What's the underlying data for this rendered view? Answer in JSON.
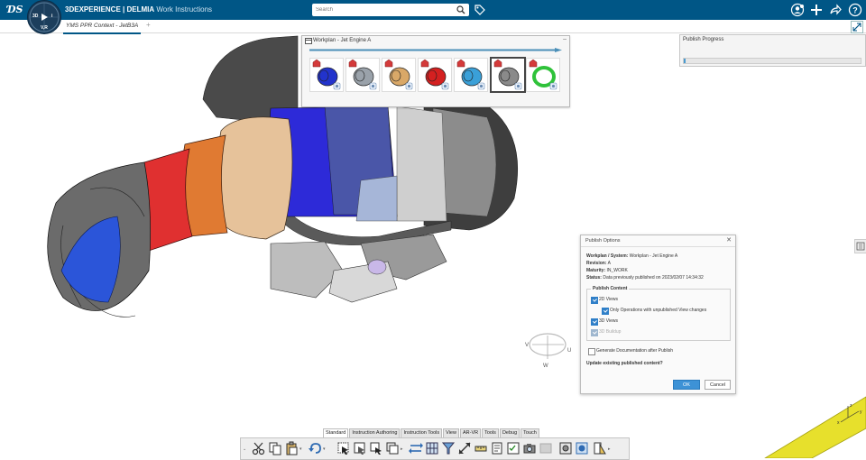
{
  "topbar": {
    "brand_name": "3DEXPERIENCE | DELMIA",
    "app_name": "Work Instructions",
    "search_placeholder": "Search",
    "compass_labels": {
      "north": "3D",
      "west": "3D",
      "east": "i",
      "south": "V,R"
    },
    "accent_color": "#005686"
  },
  "tabs": {
    "context_tab": "YMS PPR Context - JetB3A"
  },
  "workplan": {
    "title": "Workplan - Jet Engine A",
    "thumbnails": [
      {
        "name": "fan-blue",
        "color": "#2233cc"
      },
      {
        "name": "compressor-silver",
        "color": "#9aa2aa"
      },
      {
        "name": "combustor-tan",
        "color": "#d9a868"
      },
      {
        "name": "turbine-red",
        "color": "#d42020"
      },
      {
        "name": "assembly-mixed",
        "color": "#3aa0d8"
      },
      {
        "name": "frame-gray",
        "color": "#8a8a8a"
      },
      {
        "name": "ring-green",
        "color": "#2fc23a"
      }
    ],
    "selected_index": 5
  },
  "publish_progress": {
    "title": "Publish Progress",
    "progress_fraction": 0.01
  },
  "dialog": {
    "title": "Publish Options",
    "workplan_label": "Workplan / System:",
    "workplan_value": "Workplan - Jet Engine A",
    "revision_label": "Revision:",
    "revision_value": "A",
    "maturity_label": "Maturity:",
    "maturity_value": "IN_WORK",
    "status_label": "Status:",
    "status_value": "Data previously published on 2023/02/07 14:34:32",
    "publish_content_label": "Publish Content",
    "options": [
      {
        "label": "2D Views",
        "checked": true,
        "disabled": false
      },
      {
        "label": "Only Operations with unpublished View changes",
        "checked": true,
        "disabled": false
      },
      {
        "label": "3D Views",
        "checked": true,
        "disabled": false
      },
      {
        "label": "3D Buildup",
        "checked": true,
        "disabled": true
      }
    ],
    "generate_doc_label": "Generate Documentation after Publish",
    "generate_doc_checked": false,
    "question": "Update existing published content?",
    "ok_label": "OK",
    "cancel_label": "Cancel"
  },
  "compass_3d": {
    "u": "U",
    "v": "V",
    "w": "W"
  },
  "axis_labels": {
    "x": "x",
    "y": "y",
    "z": "z"
  },
  "action_bar": {
    "tabs": [
      "Standard",
      "Instruction Authoring",
      "Instruction Tools",
      "View",
      "AR-VR",
      "Tools",
      "Debug",
      "Touch"
    ],
    "active_tab": "Standard"
  }
}
